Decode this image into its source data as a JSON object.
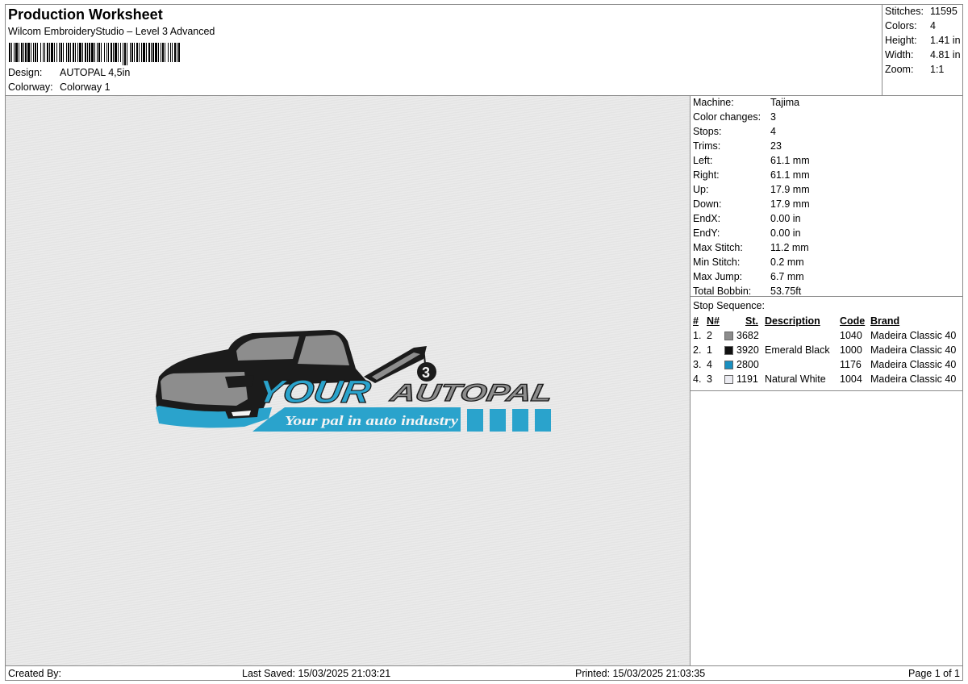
{
  "header": {
    "title": "Production Worksheet",
    "subtitle": "Wilcom EmbroideryStudio – Level 3 Advanced",
    "design_label": "Design:",
    "design_value": "AUTOPAL 4,5in",
    "colorway_label": "Colorway:",
    "colorway_value": "Colorway 1"
  },
  "stats": [
    {
      "label": "Stitches:",
      "value": "11595"
    },
    {
      "label": "Colors:",
      "value": "4"
    },
    {
      "label": "Height:",
      "value": "1.41 in"
    },
    {
      "label": "Width:",
      "value": "4.81 in"
    },
    {
      "label": "Zoom:",
      "value": "1:1"
    }
  ],
  "machine_info": [
    {
      "label": "Machine:",
      "value": "Tajima"
    },
    {
      "label": "Color changes:",
      "value": "3"
    },
    {
      "label": "Stops:",
      "value": "4"
    },
    {
      "label": "Trims:",
      "value": "23"
    },
    {
      "label": "Left:",
      "value": "61.1 mm"
    },
    {
      "label": "Right:",
      "value": "61.1 mm"
    },
    {
      "label": "Up:",
      "value": "17.9 mm"
    },
    {
      "label": "Down:",
      "value": "17.9 mm"
    },
    {
      "label": "EndX:",
      "value": "0.00 in"
    },
    {
      "label": "EndY:",
      "value": "0.00 in"
    },
    {
      "label": "Max Stitch:",
      "value": "11.2 mm"
    },
    {
      "label": "Min Stitch:",
      "value": "0.2 mm"
    },
    {
      "label": "Max Jump:",
      "value": "6.7 mm"
    },
    {
      "label": "Total Bobbin:",
      "value": "53.75ft"
    }
  ],
  "stop_sequence": {
    "title": "Stop Sequence:",
    "columns": {
      "num": "#",
      "n": "N#",
      "st": "St.",
      "desc": "Description",
      "code": "Code",
      "brand": "Brand"
    },
    "rows": [
      {
        "num": "1.",
        "n": "2",
        "color": "#8c8c8c",
        "st": "3682",
        "desc": "",
        "code": "1040",
        "brand": "Madeira Classic 40"
      },
      {
        "num": "2.",
        "n": "1",
        "color": "#111111",
        "st": "3920",
        "desc": "Emerald Black",
        "code": "1000",
        "brand": "Madeira Classic 40"
      },
      {
        "num": "3.",
        "n": "4",
        "color": "#1a8fc0",
        "st": "2800",
        "desc": "",
        "code": "1176",
        "brand": "Madeira Classic 40"
      },
      {
        "num": "4.",
        "n": "3",
        "color": "#ececf2",
        "st": "1191",
        "desc": "Natural White",
        "code": "1004",
        "brand": "Madeira Classic 40"
      }
    ]
  },
  "design": {
    "word1": "YOUR",
    "word2": "AUTOPAL",
    "tagline": "Your pal in auto industry",
    "hook_number": "3",
    "colors": {
      "black": "#1b1b1b",
      "gray": "#8d8d8d",
      "blue": "#2aa3cc",
      "white": "#f4f4f4"
    }
  },
  "footer": {
    "created_by": "Created By:",
    "last_saved": "Last Saved: 15/03/2025 21:03:21",
    "printed": "Printed: 15/03/2025 21:03:35",
    "page": "Page 1 of 1"
  }
}
